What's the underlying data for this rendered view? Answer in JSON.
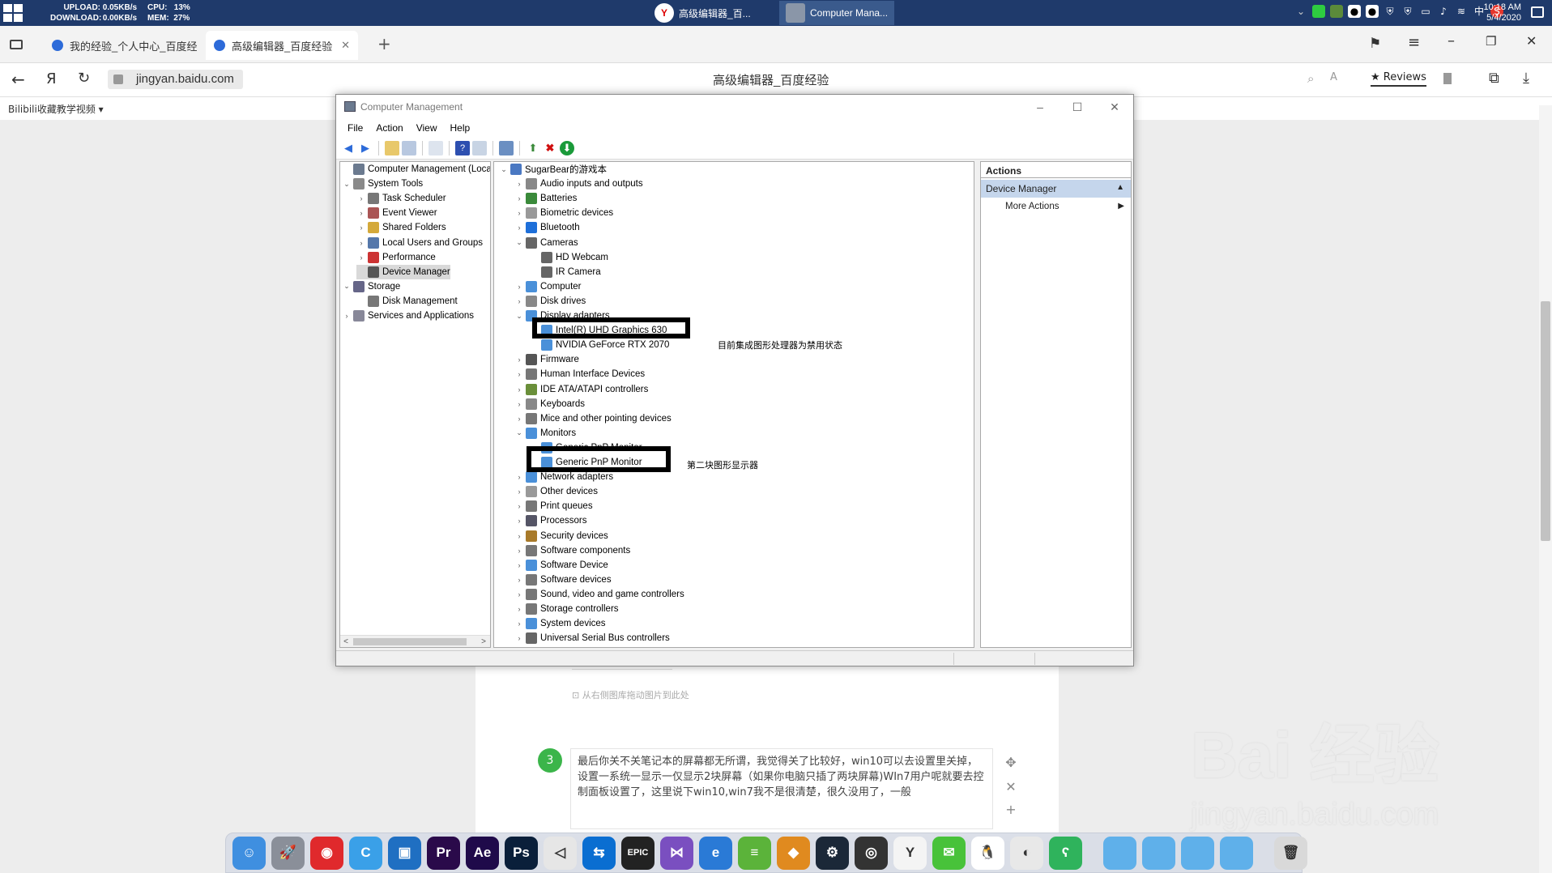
{
  "taskbar": {
    "upload_label": "UPLOAD:",
    "upload_value": "0.05KB/s",
    "download_label": "DOWNLOAD:",
    "download_value": "0.00KB/s",
    "cpu_label": "CPU:",
    "cpu_value": "13%",
    "mem_label": "MEM:",
    "mem_value": "27%",
    "apps": [
      {
        "label": "高级编辑器_百...",
        "icon": "yandex-icon"
      },
      {
        "label": "Computer Mana...",
        "icon": "computer-management-icon"
      }
    ],
    "tray": {
      "ime": "中"
    },
    "clock_time": "10:18 AM",
    "clock_date": "5/4/2020"
  },
  "browser": {
    "tabs": [
      {
        "label": "我的经验_个人中心_百度经"
      },
      {
        "label": "高级编辑器_百度经验"
      }
    ],
    "url": "jingyan.baidu.com",
    "page_title": "高级编辑器_百度经验",
    "reviews_label": "Reviews",
    "bookmark_label": "Bilibili收藏教学视频"
  },
  "article": {
    "upload_hint": "从右侧图库拖动图片到此处",
    "step_number": "3",
    "step_text": "最后你关不关笔记本的屏幕都无所谓，我觉得关了比较好，win10可以去设置里关掉，设置一系统一显示一仅显示2块屏幕（如果你电脑只插了两块屏幕)WIn7用户呢就要去控制面板设置了，这里说下win10,win7我不是很清楚，很久没用了，一般",
    "watermark_main": "Bai 经验",
    "watermark_sub": "jingyan.baidu.com"
  },
  "cm": {
    "title": "Computer Management",
    "menu": [
      "File",
      "Action",
      "View",
      "Help"
    ],
    "left_tree": [
      {
        "label": "Computer Management (Local",
        "level": 0,
        "exp": "",
        "color": "#6b7a8f"
      },
      {
        "label": "System Tools",
        "level": 0,
        "exp": "v",
        "color": "#8a8a8a"
      },
      {
        "label": "Task Scheduler",
        "level": 1,
        "exp": ">",
        "color": "#777"
      },
      {
        "label": "Event Viewer",
        "level": 1,
        "exp": ">",
        "color": "#a55"
      },
      {
        "label": "Shared Folders",
        "level": 1,
        "exp": ">",
        "color": "#d4a93a"
      },
      {
        "label": "Local Users and Groups",
        "level": 1,
        "exp": ">",
        "color": "#5577aa"
      },
      {
        "label": "Performance",
        "level": 1,
        "exp": ">",
        "color": "#c33"
      },
      {
        "label": "Device Manager",
        "level": 1,
        "exp": "",
        "color": "#555",
        "selected": true
      },
      {
        "label": "Storage",
        "level": 0,
        "exp": "v",
        "color": "#668"
      },
      {
        "label": "Disk Management",
        "level": 1,
        "exp": "",
        "color": "#777"
      },
      {
        "label": "Services and Applications",
        "level": 0,
        "exp": ">",
        "color": "#889"
      }
    ],
    "device_tree": [
      {
        "label": "SugarBear的游戏本",
        "level": 0,
        "exp": "v",
        "color": "#4a78c2"
      },
      {
        "label": "Audio inputs and outputs",
        "level": 1,
        "exp": ">",
        "color": "#888"
      },
      {
        "label": "Batteries",
        "level": 1,
        "exp": ">",
        "color": "#3a8a3a"
      },
      {
        "label": "Biometric devices",
        "level": 1,
        "exp": ">",
        "color": "#999"
      },
      {
        "label": "Bluetooth",
        "level": 1,
        "exp": ">",
        "color": "#1e6fd9"
      },
      {
        "label": "Cameras",
        "level": 1,
        "exp": "v",
        "color": "#666"
      },
      {
        "label": "HD Webcam",
        "level": 2,
        "exp": "",
        "color": "#666"
      },
      {
        "label": "IR Camera",
        "level": 2,
        "exp": "",
        "color": "#666"
      },
      {
        "label": "Computer",
        "level": 1,
        "exp": ">",
        "color": "#4a90d9"
      },
      {
        "label": "Disk drives",
        "level": 1,
        "exp": ">",
        "color": "#888"
      },
      {
        "label": "Display adapters",
        "level": 1,
        "exp": "v",
        "color": "#4a90d9"
      },
      {
        "label": "Intel(R) UHD Graphics 630",
        "level": 2,
        "exp": "",
        "color": "#4a90d9"
      },
      {
        "label": "NVIDIA GeForce RTX 2070",
        "level": 2,
        "exp": "",
        "color": "#4a90d9"
      },
      {
        "label": "Firmware",
        "level": 1,
        "exp": ">",
        "color": "#555"
      },
      {
        "label": "Human Interface Devices",
        "level": 1,
        "exp": ">",
        "color": "#777"
      },
      {
        "label": "IDE ATA/ATAPI controllers",
        "level": 1,
        "exp": ">",
        "color": "#6a8f3a"
      },
      {
        "label": "Keyboards",
        "level": 1,
        "exp": ">",
        "color": "#888"
      },
      {
        "label": "Mice and other pointing devices",
        "level": 1,
        "exp": ">",
        "color": "#777"
      },
      {
        "label": "Monitors",
        "level": 1,
        "exp": "v",
        "color": "#4a90d9"
      },
      {
        "label": "Generic PnP Monitor",
        "level": 2,
        "exp": "",
        "color": "#4a90d9"
      },
      {
        "label": "Generic PnP Monitor",
        "level": 2,
        "exp": "",
        "color": "#4a90d9"
      },
      {
        "label": "Network adapters",
        "level": 1,
        "exp": ">",
        "color": "#4a90d9"
      },
      {
        "label": "Other devices",
        "level": 1,
        "exp": ">",
        "color": "#999"
      },
      {
        "label": "Print queues",
        "level": 1,
        "exp": ">",
        "color": "#777"
      },
      {
        "label": "Processors",
        "level": 1,
        "exp": ">",
        "color": "#556"
      },
      {
        "label": "Security devices",
        "level": 1,
        "exp": ">",
        "color": "#a87a2a"
      },
      {
        "label": "Software components",
        "level": 1,
        "exp": ">",
        "color": "#777"
      },
      {
        "label": "Software Device",
        "level": 1,
        "exp": ">",
        "color": "#4a90d9"
      },
      {
        "label": "Software devices",
        "level": 1,
        "exp": ">",
        "color": "#777"
      },
      {
        "label": "Sound, video and game controllers",
        "level": 1,
        "exp": ">",
        "color": "#777"
      },
      {
        "label": "Storage controllers",
        "level": 1,
        "exp": ">",
        "color": "#777"
      },
      {
        "label": "System devices",
        "level": 1,
        "exp": ">",
        "color": "#4a90d9"
      },
      {
        "label": "Universal Serial Bus controllers",
        "level": 1,
        "exp": ">",
        "color": "#666"
      }
    ],
    "actions": {
      "header": "Actions",
      "section": "Device Manager",
      "more": "More Actions"
    }
  },
  "annotations": {
    "note1": "目前集成图形处理器为禁用状态",
    "note2": "第二块图形显示器"
  },
  "dock": [
    {
      "name": "finder-icon",
      "color": "#3f8fe0",
      "glyph": "☺"
    },
    {
      "name": "launchpad-icon",
      "color": "#8a8f99",
      "glyph": "🚀"
    },
    {
      "name": "netease-music-icon",
      "color": "#e0292c",
      "glyph": "◉"
    },
    {
      "name": "browser-c-icon",
      "color": "#3aa0e8",
      "glyph": "C"
    },
    {
      "name": "remote-desktop-icon",
      "color": "#1f6fc2",
      "glyph": "▣"
    },
    {
      "name": "premiere-icon",
      "color": "#2a0a4a",
      "glyph": "Pr"
    },
    {
      "name": "after-effects-icon",
      "color": "#1f0a4a",
      "glyph": "Ae"
    },
    {
      "name": "photoshop-icon",
      "color": "#0a1f3a",
      "glyph": "Ps"
    },
    {
      "name": "unity-icon",
      "color": "#e6e6e6",
      "glyph": "◁"
    },
    {
      "name": "teamviewer-icon",
      "color": "#0a6ed1",
      "glyph": "⇆"
    },
    {
      "name": "epic-games-icon",
      "color": "#222",
      "glyph": "EPIC"
    },
    {
      "name": "visual-studio-icon",
      "color": "#7a4fc0",
      "glyph": "⋈"
    },
    {
      "name": "edge-icon",
      "color": "#2a7ad6",
      "glyph": "e"
    },
    {
      "name": "bluestacks-icon",
      "color": "#5bb33a",
      "glyph": "≡"
    },
    {
      "name": "feather-icon",
      "color": "#e08a1f",
      "glyph": "◆"
    },
    {
      "name": "steam-icon",
      "color": "#1b2838",
      "glyph": "⚙"
    },
    {
      "name": "obs-icon",
      "color": "#333",
      "glyph": "◎"
    },
    {
      "name": "yandex-icon",
      "color": "#f4f4f4",
      "glyph": "Y"
    },
    {
      "name": "wechat-icon",
      "color": "#48c23a",
      "glyph": "✉"
    },
    {
      "name": "qq-icon",
      "color": "#ffffff",
      "glyph": "🐧"
    },
    {
      "name": "chrome-icon",
      "color": "#e8e8e8",
      "glyph": "◐"
    },
    {
      "name": "bear-icon",
      "color": "#2fb35c",
      "glyph": "ʕ"
    },
    {
      "sep": true
    },
    {
      "name": "folder-icon",
      "color": "#5fb0ea",
      "glyph": ""
    },
    {
      "name": "folder-icon",
      "color": "#5fb0ea",
      "glyph": ""
    },
    {
      "name": "folder-icon",
      "color": "#5fb0ea",
      "glyph": ""
    },
    {
      "name": "folder-icon",
      "color": "#5fb0ea",
      "glyph": ""
    },
    {
      "sep": true
    },
    {
      "name": "trash-icon",
      "color": "#d9d9d9",
      "glyph": "🗑"
    }
  ]
}
